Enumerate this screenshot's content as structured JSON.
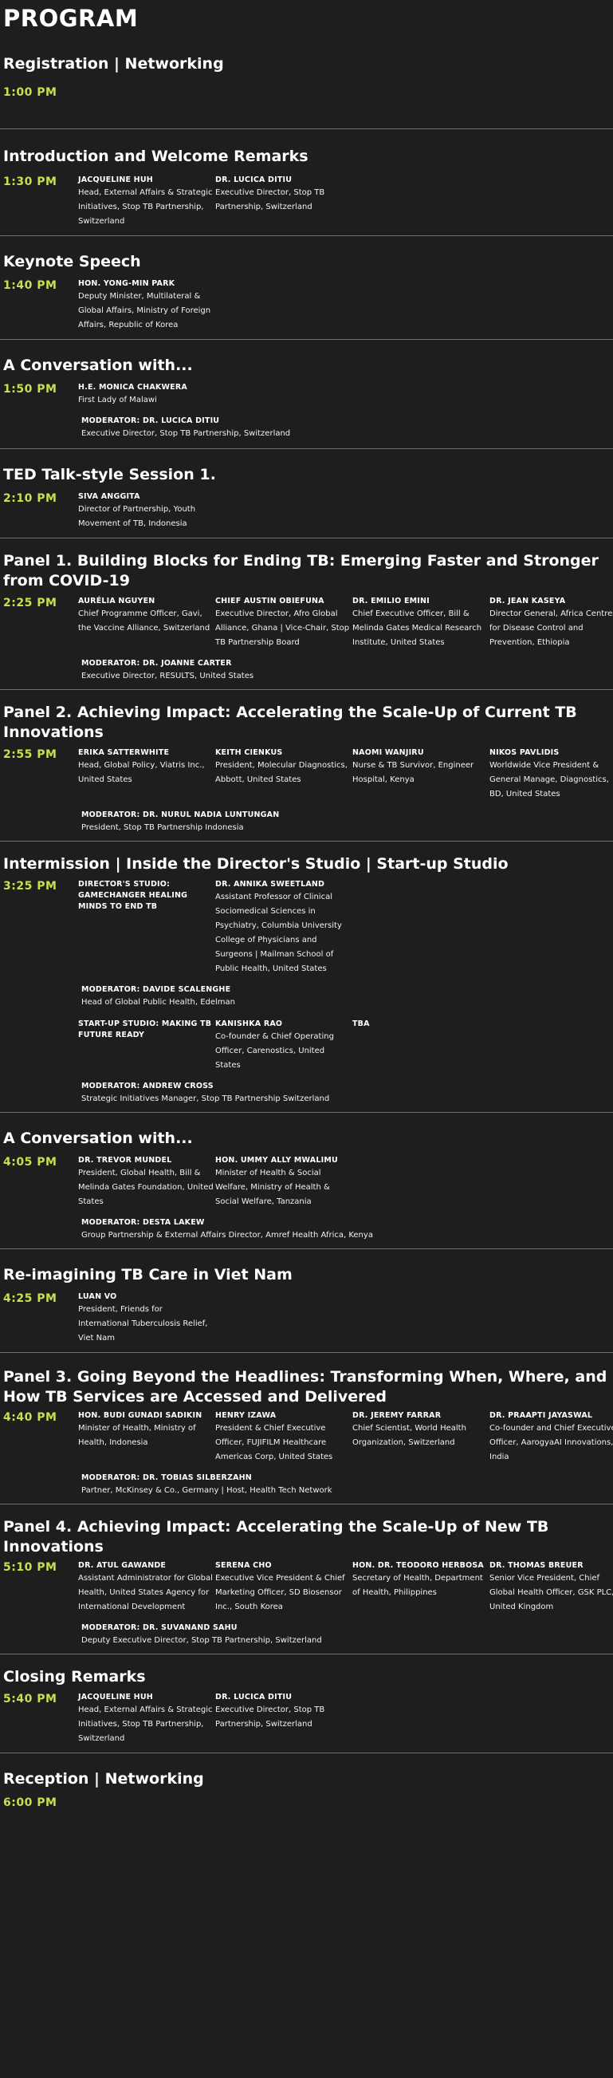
{
  "title": "PROGRAM",
  "sessions": [
    {
      "title": "Registration | Networking",
      "time": "1:00 PM",
      "speakers": [],
      "moderator": null
    },
    {
      "title": "Introduction and Welcome Remarks",
      "time": "1:30 PM",
      "speakers": [
        {
          "name": "JACQUELINE HUH",
          "role": "Head, External Affairs & Strategic Initiatives, Stop TB Partnership, Switzerland"
        },
        {
          "name": "DR. LUCICA DITIU",
          "role": "Executive Director, Stop TB Partnership, Switzerland"
        }
      ]
    },
    {
      "title": "Keynote Speech",
      "time": "1:40 PM",
      "speakers": [
        {
          "name": "HON. YONG-MIN PARK",
          "role": "Deputy Minister, Multilateral & Global Affairs, Ministry of Foreign Affairs, Republic of Korea"
        }
      ]
    },
    {
      "title": "A Conversation with...",
      "time": "1:50 PM",
      "speakers": [
        {
          "name": "H.E. MONICA CHAKWERA",
          "role": "First Lady of Malawi"
        }
      ],
      "moderator": {
        "name": "MODERATOR: DR. LUCICA DITIU",
        "role": "Executive Director, Stop TB Partnership, Switzerland"
      }
    },
    {
      "title": "TED Talk-style Session 1.",
      "time": "2:10 PM",
      "speakers": [
        {
          "name": "SIVA ANGGITA",
          "role": "Director of Partnership, Youth Movement of TB, Indonesia"
        }
      ]
    },
    {
      "title": "Panel 1. Building Blocks for Ending TB: Emerging Faster and Stronger from COVID-19",
      "time": "2:25 PM",
      "speakers": [
        {
          "name": "AURÉLIA NGUYEN",
          "role": "Chief Programme Officer, Gavi, the Vaccine Alliance, Switzerland"
        },
        {
          "name": "CHIEF AUSTIN OBIEFUNA",
          "role": "Executive Director, Afro Global Alliance, Ghana | Vice-Chair, Stop TB Partnership Board"
        },
        {
          "name": "DR. EMILIO EMINI",
          "role": "Chief Executive Officer, Bill & Melinda Gates Medical Research Institute, United States"
        },
        {
          "name": "DR. JEAN KASEYA",
          "role": "Director General, Africa Centres for Disease Control and Prevention, Ethiopia"
        }
      ],
      "moderator": {
        "name": "MODERATOR: DR. JOANNE CARTER",
        "role": "Executive Director, RESULTS, United States"
      }
    },
    {
      "title": "Panel 2. Achieving Impact: Accelerating the Scale-Up of Current TB Innovations",
      "time": "2:55 PM",
      "speakers": [
        {
          "name": "ERIKA SATTERWHITE",
          "role": "Head, Global Policy, Viatris Inc., United States"
        },
        {
          "name": "KEITH CIENKUS",
          "role": "President, Molecular Diagnostics, Abbott, United States"
        },
        {
          "name": "NAOMI WANJIRU",
          "role": "Nurse & TB Survivor, Engineer Hospital, Kenya"
        },
        {
          "name": "NIKOS PAVLIDIS",
          "role": "Worldwide Vice President & General Manage, Diagnostics, BD, United States"
        }
      ],
      "moderator": {
        "name": "MODERATOR: DR. NURUL NADIA LUNTUNGAN",
        "role": "President, Stop TB Partnership Indonesia"
      }
    },
    {
      "title": "Intermission | Inside the Director's Studio | Start-up Studio",
      "time": "3:25 PM",
      "speakers": [
        {
          "name": "DIRECTOR'S STUDIO: GAMECHANGER HEALING MINDS TO END TB",
          "role": ""
        },
        {
          "name": "DR. ANNIKA SWEETLAND",
          "role": "Assistant Professor of Clinical Sociomedical Sciences in Psychiatry, Columbia University College of Physicians and Surgeons | Mailman School of Public Health, United States"
        }
      ],
      "moderator": {
        "name": "MODERATOR: DAVIDE SCALENGHE",
        "role": "Head of Global Public Health, Edelman"
      },
      "speakers2": [
        {
          "name": "START-UP STUDIO: MAKING TB FUTURE READY",
          "role": ""
        },
        {
          "name": "KANISHKA RAO",
          "role": "Co-founder & Chief Operating Officer, Carenostics, United States"
        },
        {
          "name": "TBA",
          "role": ""
        }
      ],
      "moderator2": {
        "name": "MODERATOR: ANDREW CROSS",
        "role": "Strategic Initiatives Manager, Stop TB Partnership Switzerland"
      }
    },
    {
      "title": "A Conversation with...",
      "time": "4:05 PM",
      "speakers": [
        {
          "name": "DR. TREVOR MUNDEL",
          "role": "President, Global Health, Bill & Melinda Gates Foundation, United States"
        },
        {
          "name": "HON. UMMY ALLY MWALIMU",
          "role": "Minister of Health & Social Welfare, Ministry of Health & Social Welfare, Tanzania"
        }
      ],
      "moderator": {
        "name": "MODERATOR: DESTA LAKEW",
        "role": "Group Partnership & External Affairs Director, Amref Health Africa, Kenya"
      }
    },
    {
      "title": "Re-imagining TB Care in Viet Nam",
      "time": "4:25 PM",
      "speakers": [
        {
          "name": "LUAN VO",
          "role": "President, Friends for International Tuberculosis Relief, Viet Nam"
        }
      ]
    },
    {
      "title": "Panel 3. Going Beyond the Headlines: Transforming When, Where, and How TB Services are Accessed and Delivered",
      "time": "4:40 PM",
      "speakers": [
        {
          "name": "HON. BUDI GUNADI SADIKIN",
          "role": "Minister of Health, Ministry of Health, Indonesia"
        },
        {
          "name": "HENRY IZAWA",
          "role": "President & Chief Executive Officer, FUJIFILM Healthcare Americas Corp, United States"
        },
        {
          "name": "DR. JEREMY FARRAR",
          "role": "Chief Scientist, World Health Organization, Switzerland"
        },
        {
          "name": "DR. PRAAPTI JAYASWAL",
          "role": "Co-founder and Chief Executive Officer, AarogyaAI Innovations, India"
        }
      ],
      "moderator": {
        "name": "MODERATOR: DR. TOBIAS SILBERZAHN",
        "role": "Partner, McKinsey & Co., Germany | Host, Health Tech Network"
      }
    },
    {
      "title": "Panel 4. Achieving Impact: Accelerating the Scale-Up of New TB Innovations",
      "time": "5:10 PM",
      "speakers": [
        {
          "name": "DR. ATUL GAWANDE",
          "role": "Assistant Administrator for Global Health, United States Agency for International Development"
        },
        {
          "name": "SERENA CHO",
          "role": "Executive Vice President & Chief Marketing Officer, SD Biosensor Inc., South Korea"
        },
        {
          "name": "HON. DR. TEODORO HERBOSA",
          "role": "Secretary of Health, Department of Health, Philippines"
        },
        {
          "name": "DR. THOMAS BREUER",
          "role": "Senior Vice President, Chief Global Health Officer, GSK PLC, United Kingdom"
        }
      ],
      "moderator": {
        "name": "MODERATOR: DR. SUVANAND SAHU",
        "role": "Deputy Executive Director, Stop TB Partnership, Switzerland"
      }
    },
    {
      "title": "Closing Remarks",
      "time": "5:40 PM",
      "speakers": [
        {
          "name": "JACQUELINE HUH",
          "role": "Head, External Affairs & Strategic Initiatives, Stop TB Partnership, Switzerland"
        },
        {
          "name": "DR. LUCICA DITIU",
          "role": "Executive Director, Stop TB Partnership, Switzerland"
        }
      ]
    },
    {
      "title": "Reception | Networking",
      "time": "6:00 PM",
      "speakers": []
    }
  ]
}
